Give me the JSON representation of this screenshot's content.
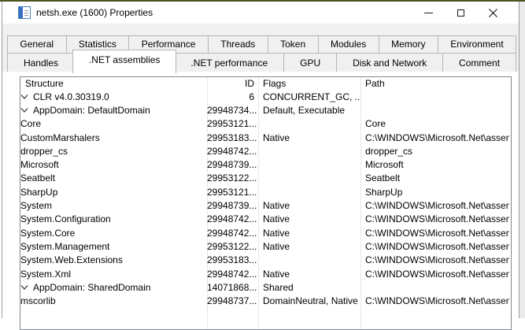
{
  "window": {
    "title": "netsh.exe (1600) Properties",
    "controls": [
      "minimize",
      "maximize",
      "close"
    ]
  },
  "tabs": {
    "row1": [
      {
        "label": "General"
      },
      {
        "label": "Statistics"
      },
      {
        "label": "Performance"
      },
      {
        "label": "Threads"
      },
      {
        "label": "Token"
      },
      {
        "label": "Modules"
      },
      {
        "label": "Memory"
      },
      {
        "label": "Environment"
      }
    ],
    "row2": [
      {
        "label": "Handles"
      },
      {
        "label": ".NET assemblies",
        "active": true
      },
      {
        "label": ".NET performance"
      },
      {
        "label": "GPU"
      },
      {
        "label": "Disk and Network"
      },
      {
        "label": "Comment"
      }
    ]
  },
  "list": {
    "columns": [
      "Structure",
      "ID",
      "Flags",
      "Path"
    ],
    "rows": [
      {
        "level": 0,
        "expandable": true,
        "structure": "CLR v4.0.30319.0",
        "id": "6",
        "flags": "CONCURRENT_GC, ...",
        "path": ""
      },
      {
        "level": 1,
        "expandable": true,
        "structure": "AppDomain: DefaultDomain",
        "id": "29948734...",
        "flags": "Default, Executable",
        "path": ""
      },
      {
        "level": 2,
        "expandable": false,
        "structure": "Core",
        "id": "29953121...",
        "flags": "",
        "path": "Core"
      },
      {
        "level": 2,
        "expandable": false,
        "structure": "CustomMarshalers",
        "id": "29953183...",
        "flags": "Native",
        "path": "C:\\WINDOWS\\Microsoft.Net\\assembly"
      },
      {
        "level": 2,
        "expandable": false,
        "structure": "dropper_cs",
        "id": "29948742...",
        "flags": "",
        "path": "dropper_cs"
      },
      {
        "level": 2,
        "expandable": false,
        "structure": "Microsoft",
        "id": "29948739...",
        "flags": "",
        "path": "Microsoft"
      },
      {
        "level": 2,
        "expandable": false,
        "structure": "Seatbelt",
        "id": "29953122...",
        "flags": "",
        "path": "Seatbelt"
      },
      {
        "level": 2,
        "expandable": false,
        "structure": "SharpUp",
        "id": "29953121...",
        "flags": "",
        "path": "SharpUp"
      },
      {
        "level": 2,
        "expandable": false,
        "structure": "System",
        "id": "29948739...",
        "flags": "Native",
        "path": "C:\\WINDOWS\\Microsoft.Net\\assembly"
      },
      {
        "level": 2,
        "expandable": false,
        "structure": "System.Configuration",
        "id": "29948742...",
        "flags": "Native",
        "path": "C:\\WINDOWS\\Microsoft.Net\\assembly"
      },
      {
        "level": 2,
        "expandable": false,
        "structure": "System.Core",
        "id": "29948742...",
        "flags": "Native",
        "path": "C:\\WINDOWS\\Microsoft.Net\\assembly"
      },
      {
        "level": 2,
        "expandable": false,
        "structure": "System.Management",
        "id": "29953122...",
        "flags": "Native",
        "path": "C:\\WINDOWS\\Microsoft.Net\\assembly"
      },
      {
        "level": 2,
        "expandable": false,
        "structure": "System.Web.Extensions",
        "id": "29953183...",
        "flags": "",
        "path": "C:\\WINDOWS\\Microsoft.Net\\assembly"
      },
      {
        "level": 2,
        "expandable": false,
        "structure": "System.Xml",
        "id": "29948742...",
        "flags": "Native",
        "path": "C:\\WINDOWS\\Microsoft.Net\\assembly"
      },
      {
        "level": 1,
        "expandable": true,
        "structure": "AppDomain: SharedDomain",
        "id": "14071868...",
        "flags": "Shared",
        "path": ""
      },
      {
        "level": 2,
        "expandable": false,
        "structure": "mscorlib",
        "id": "29948737...",
        "flags": "DomainNeutral, Native",
        "path": "C:\\WINDOWS\\Microsoft.Net\\assembly"
      }
    ]
  },
  "colors": {
    "top_strip": "#4b531e",
    "icon_blue": "#3b6fc4",
    "dialog_bg": "#f0f0f0",
    "tab_border": "#b6b6b6",
    "list_border": "#828790"
  }
}
